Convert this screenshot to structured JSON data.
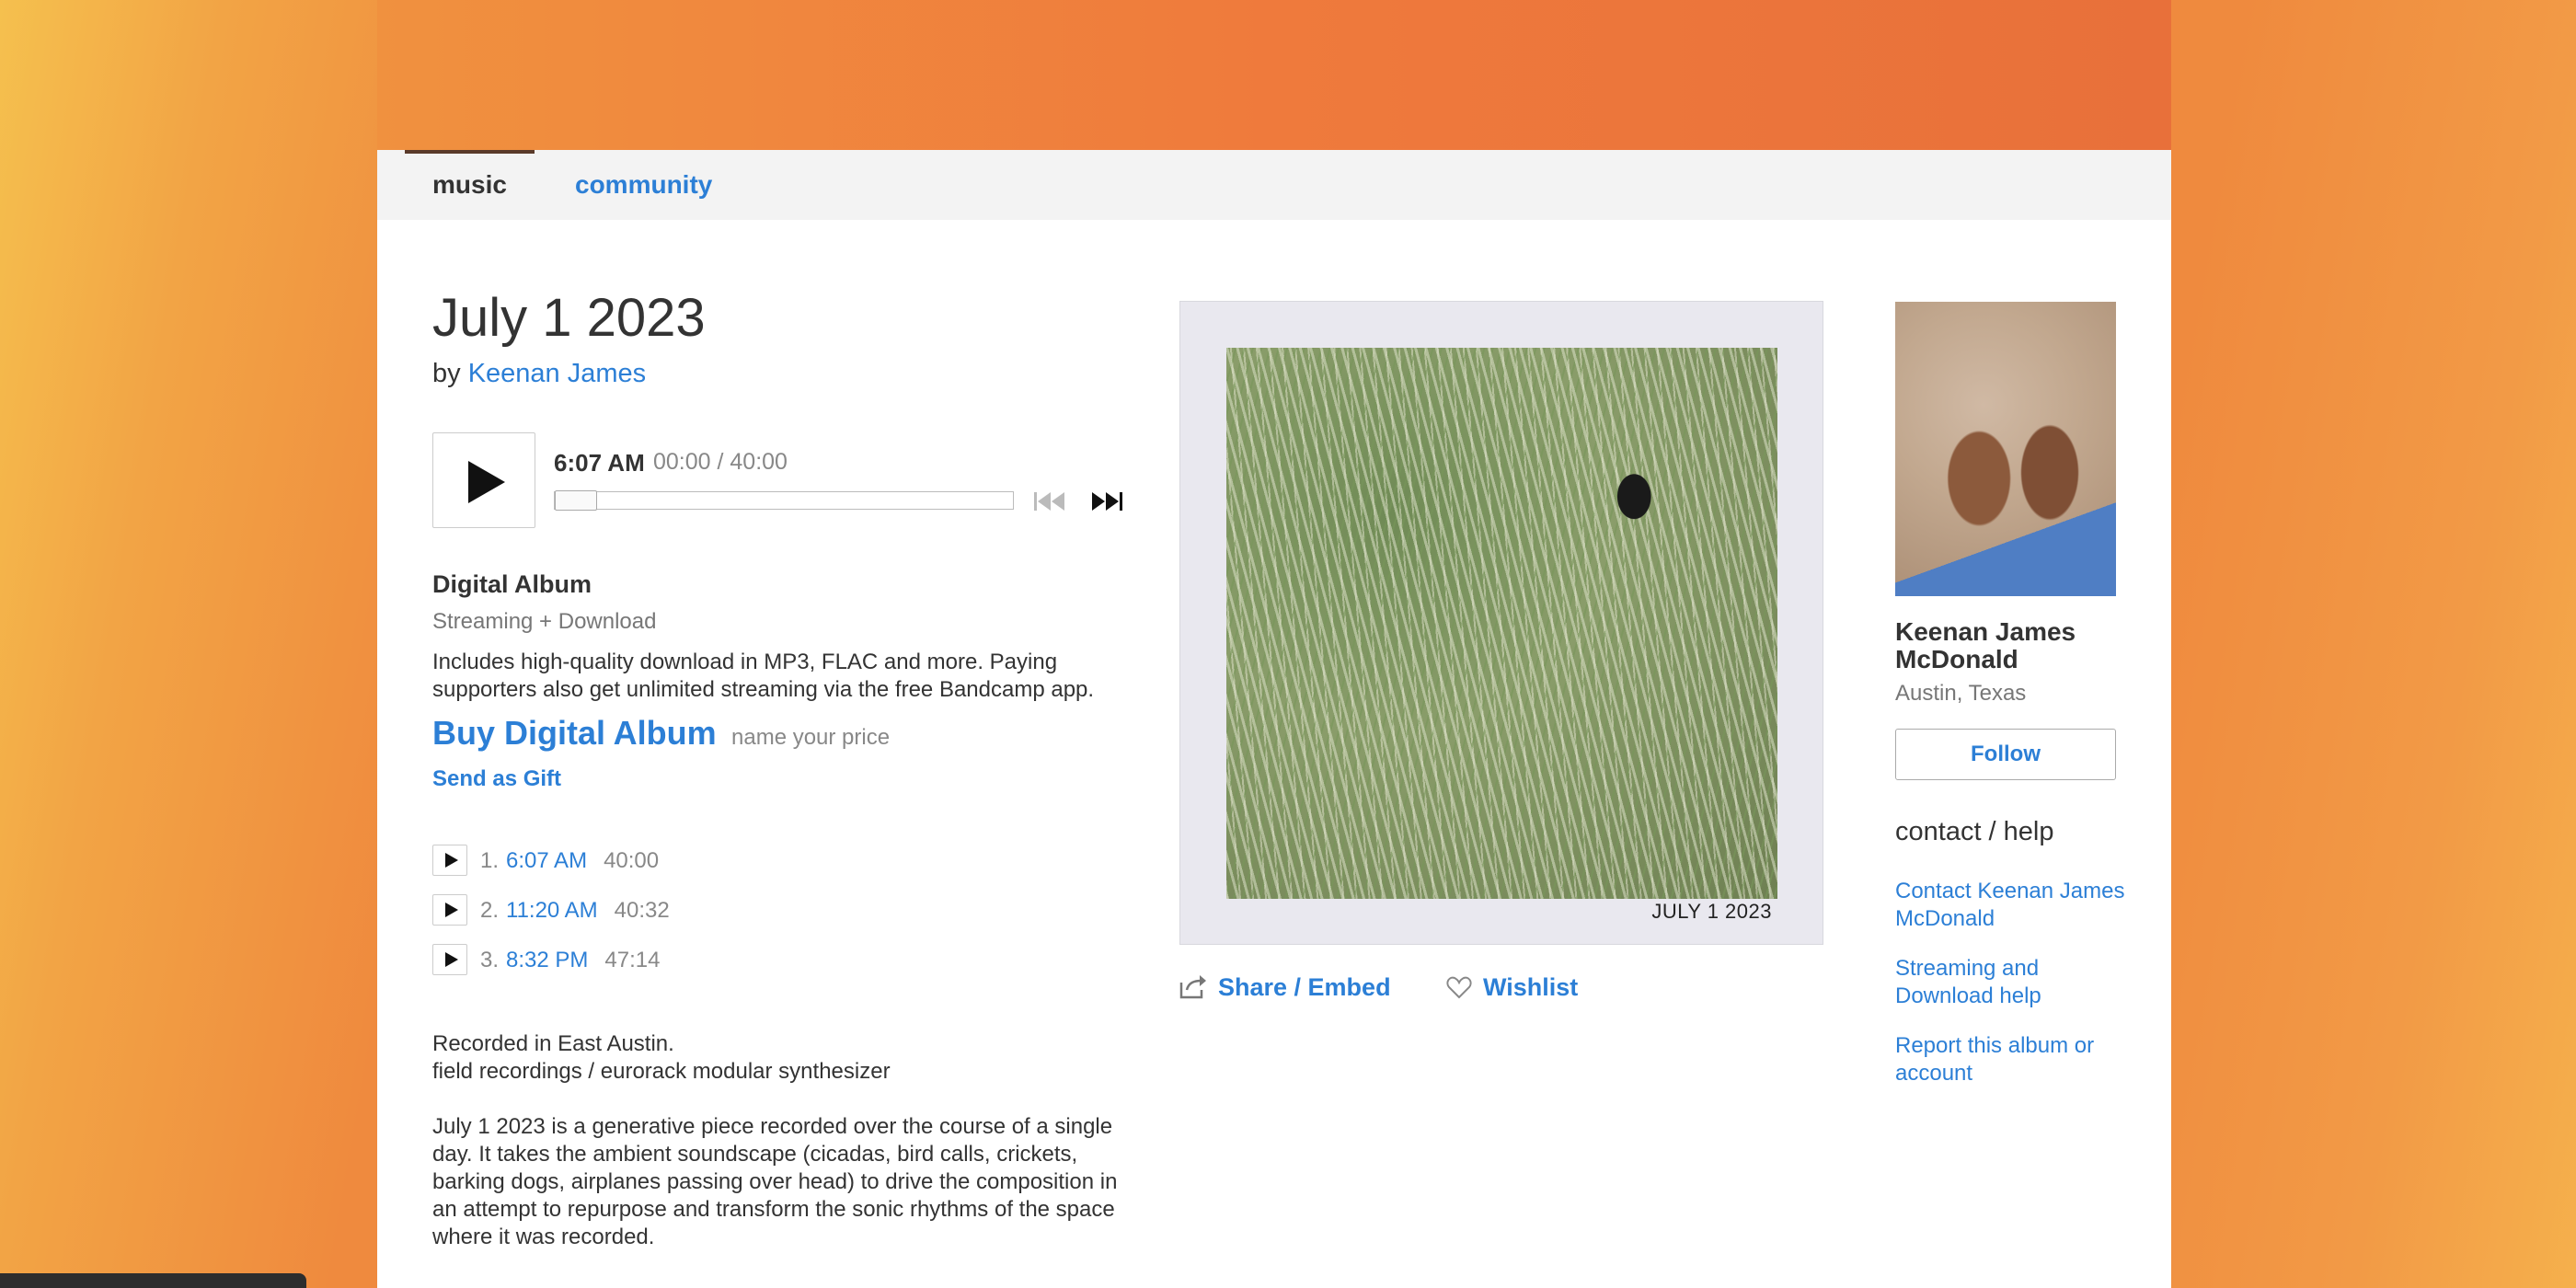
{
  "nav": {
    "tabs": [
      {
        "label": "music"
      },
      {
        "label": "community"
      }
    ]
  },
  "album": {
    "title": "July 1 2023",
    "by_prefix": "by",
    "artist": "Keenan James"
  },
  "player": {
    "current_track": "6:07 AM",
    "time": "00:00 / 40:00",
    "progress": 0
  },
  "purchase": {
    "format_title": "Digital Album",
    "format_sub": "Streaming + Download",
    "description": "Includes high-quality download in MP3, FLAC and more. Paying supporters also get unlimited streaming via the free Bandcamp app.",
    "buy_label": "Buy Digital Album",
    "price_note": "name your price",
    "gift_label": "Send as Gift"
  },
  "tracks": [
    {
      "num": "1.",
      "title": "6:07 AM",
      "length": "40:00"
    },
    {
      "num": "2.",
      "title": "11:20 AM",
      "length": "40:32"
    },
    {
      "num": "3.",
      "title": "8:32 PM",
      "length": "47:14"
    }
  ],
  "notes": {
    "credits_line1": "Recorded in East Austin.",
    "credits_line2": "field recordings / eurorack modular synthesizer",
    "about": "July 1 2023 is a generative piece recorded over the course of a single day. It takes the ambient soundscape (cicadas, bird calls, crickets, barking dogs, airplanes passing over head) to drive the composition in an attempt to repurpose and transform the sonic rhythms of the space where it was recorded."
  },
  "artwork": {
    "caption": "JULY 1 2023"
  },
  "actions": {
    "share_label": "Share / Embed",
    "wishlist_label": "Wishlist"
  },
  "artist_panel": {
    "name": "Keenan James McDonald",
    "location": "Austin, Texas",
    "follow_label": "Follow",
    "contact_heading": "contact / help",
    "links": [
      "Contact Keenan James McDonald",
      "Streaming and Download help",
      "Report this album or account"
    ]
  },
  "colors": {
    "link": "#2c7fd6",
    "banner": "#ef7a3c"
  }
}
